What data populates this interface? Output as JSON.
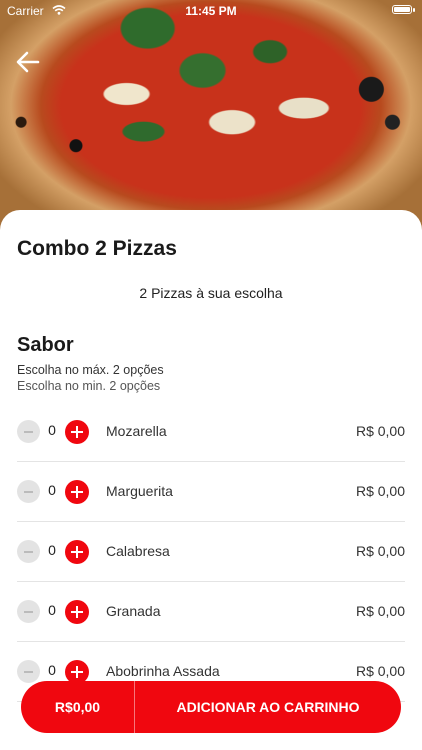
{
  "status_bar": {
    "carrier": "Carrier",
    "time": "11:45 PM"
  },
  "icons": {
    "back": "arrow-left-icon",
    "wifi": "wifi-icon",
    "battery": "battery-icon"
  },
  "colors": {
    "accent": "#f0070f",
    "stepper_disabled": "#e3e3e3"
  },
  "product": {
    "title": "Combo 2 Pizzas",
    "description": "2 Pizzas à sua escolha"
  },
  "section": {
    "title": "Sabor",
    "rule_max": "Escolha no máx. 2 opções",
    "rule_min": "Escolha no min. 2 opções",
    "options": [
      {
        "name": "Mozarella",
        "qty": "0",
        "price": "R$ 0,00"
      },
      {
        "name": "Marguerita",
        "qty": "0",
        "price": "R$ 0,00"
      },
      {
        "name": "Calabresa",
        "qty": "0",
        "price": "R$ 0,00"
      },
      {
        "name": "Granada",
        "qty": "0",
        "price": "R$ 0,00"
      },
      {
        "name": "Abobrinha Assada",
        "qty": "0",
        "price": "R$ 0,00"
      }
    ]
  },
  "cart": {
    "total": "R$0,00",
    "add_label": "ADICIONAR AO CARRINHO"
  }
}
